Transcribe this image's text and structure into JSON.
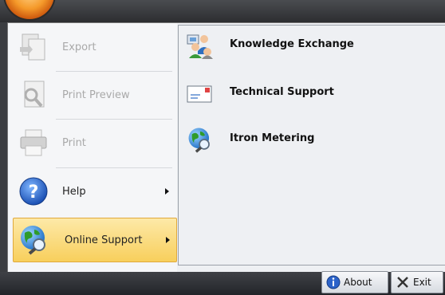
{
  "left_menu": {
    "items": [
      {
        "label": "Export",
        "enabled": false,
        "icon": "export-icon"
      },
      {
        "label": "Print Preview",
        "enabled": false,
        "icon": "print-preview-icon"
      },
      {
        "label": "Print",
        "enabled": false,
        "icon": "print-icon"
      },
      {
        "label": "Help",
        "enabled": true,
        "has_submenu": true,
        "icon": "help-icon"
      },
      {
        "label": "Online Support",
        "enabled": true,
        "has_submenu": true,
        "active": true,
        "icon": "globe-search-icon"
      }
    ]
  },
  "submenu": {
    "items": [
      {
        "label": "Knowledge Exchange",
        "icon": "users-icon"
      },
      {
        "label": "Technical Support",
        "icon": "envelope-icon"
      },
      {
        "label": "Itron Metering",
        "icon": "globe-search-icon"
      }
    ]
  },
  "footer": {
    "about_label": "About",
    "exit_label": "Exit"
  },
  "colors": {
    "active_highlight": "#f8cf5c",
    "menu_background": "#eef0f3",
    "frame_dark": "#3b3d41"
  }
}
